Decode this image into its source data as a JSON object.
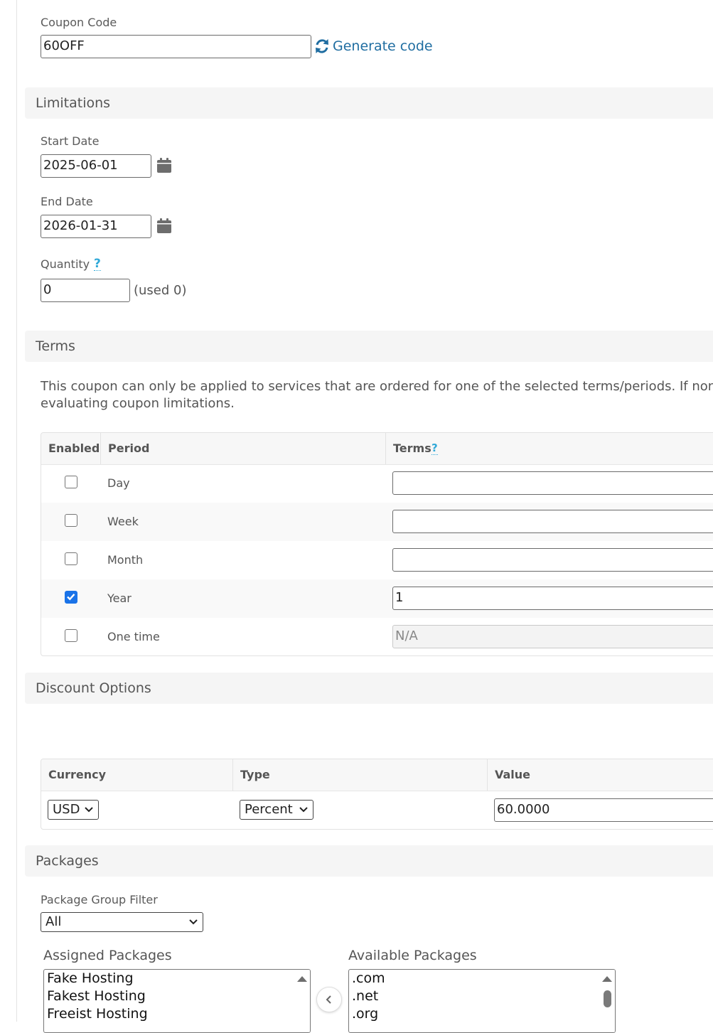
{
  "coupon": {
    "code_label": "Coupon Code",
    "code_value": "60OFF",
    "generate_label": "Generate code"
  },
  "limitations": {
    "title": "Limitations",
    "start_label": "Start Date",
    "start_value": "2025-06-01",
    "end_label": "End Date",
    "end_value": "2026-01-31",
    "quantity_label": "Quantity",
    "quantity_help": "?",
    "quantity_value": "0",
    "used_text": "(used 0)"
  },
  "terms": {
    "title": "Terms",
    "description_line1": "This coupon can only be applied to services that are ordered for one of the selected terms/periods. If none a",
    "description_line2": "evaluating coupon limitations.",
    "columns": {
      "enabled": "Enabled",
      "period": "Period",
      "terms": "Terms",
      "terms_help": "?"
    },
    "rows": [
      {
        "period": "Day",
        "checked": false,
        "terms": "",
        "disabled": false
      },
      {
        "period": "Week",
        "checked": false,
        "terms": "",
        "disabled": false
      },
      {
        "period": "Month",
        "checked": false,
        "terms": "",
        "disabled": false
      },
      {
        "period": "Year",
        "checked": true,
        "terms": "1",
        "disabled": false
      },
      {
        "period": "One time",
        "checked": false,
        "terms": "N/A",
        "disabled": true
      }
    ]
  },
  "discount": {
    "title": "Discount Options",
    "columns": {
      "currency": "Currency",
      "type": "Type",
      "value": "Value"
    },
    "currency": "USD",
    "type": "Percent",
    "value": "60.0000"
  },
  "packages": {
    "title": "Packages",
    "filter_label": "Package Group Filter",
    "filter_value": "All",
    "assigned_label": "Assigned Packages",
    "assigned": [
      "Fake Hosting",
      "Fakest Hosting",
      "Freeist Hosting"
    ],
    "available_label": "Available Packages",
    "available": [
      ".com",
      ".net",
      ".org"
    ]
  },
  "colors": {
    "accent": "#1f6da1",
    "help": "#31a9d8",
    "checkbox": "#1a73e8",
    "section_bg": "#f5f5f5"
  }
}
